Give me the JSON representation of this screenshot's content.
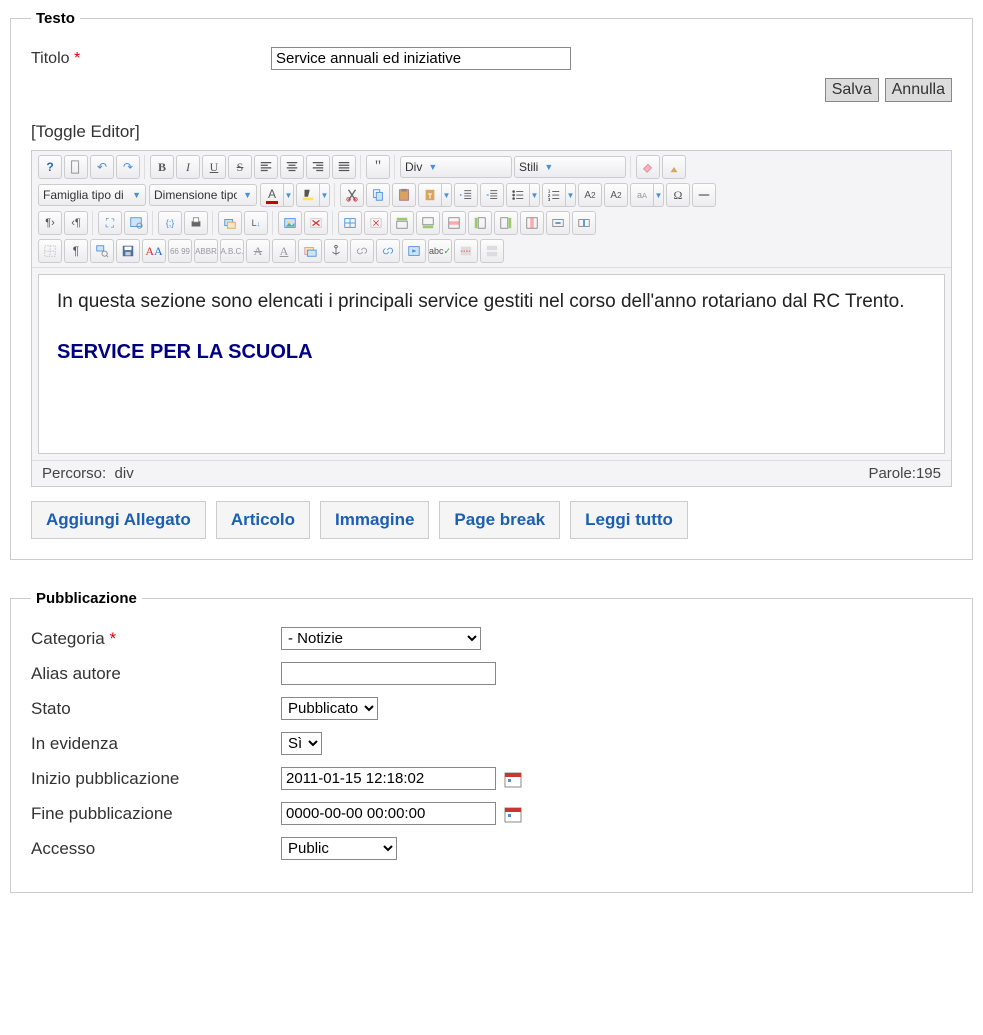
{
  "fieldsets": {
    "testo": "Testo",
    "pubblicazione": "Pubblicazione"
  },
  "labels": {
    "titolo": "Titolo",
    "toggle_editor": "[Toggle Editor]",
    "categoria": "Categoria",
    "alias_autore": "Alias autore",
    "stato": "Stato",
    "in_evidenza": "In evidenza",
    "inizio_pub": "Inizio pubblicazione",
    "fine_pub": "Fine pubblicazione",
    "accesso": "Accesso"
  },
  "values": {
    "titolo": "Service annuali ed iniziative",
    "alias_autore": "",
    "inizio_pub": "2011-01-15 12:18:02",
    "fine_pub": "0000-00-00 00:00:00"
  },
  "selects": {
    "categoria": "- Notizie",
    "stato": "Pubblicato",
    "in_evidenza": "Sì",
    "accesso": "Public",
    "format_block": "Div",
    "styles": "Stili",
    "font_family": "Famiglia tipo di carattere",
    "font_size": "Dimensione tipo di carattere"
  },
  "actions": {
    "salva": "Salva",
    "annulla": "Annulla"
  },
  "below_buttons": {
    "aggiungi_allegato": "Aggiungi Allegato",
    "articolo": "Articolo",
    "immagine": "Immagine",
    "page_break": "Page break",
    "leggi_tutto": "Leggi tutto"
  },
  "editor": {
    "content_p": "In questa sezione sono elencati i principali service gestiti nel corso dell'anno rotariano dal RC Trento.",
    "content_h": "SERVICE PER LA SCUOLA",
    "path_label": "Percorso:",
    "path_value": "div",
    "words_label": "Parole:",
    "words_value": "195"
  }
}
